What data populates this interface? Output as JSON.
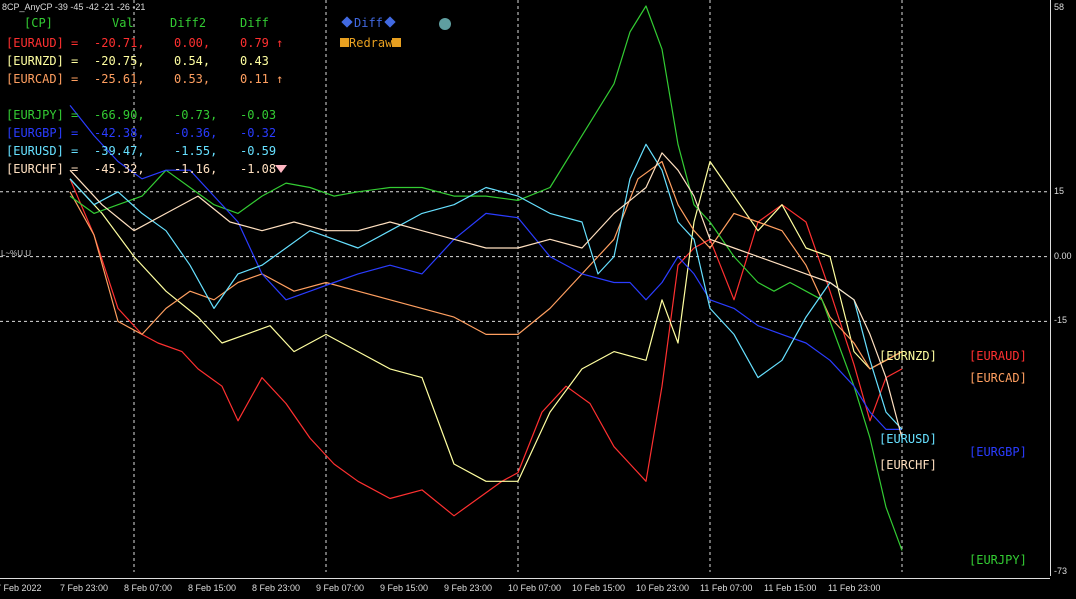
{
  "window": {
    "title": "8CP_AnyCP -39 -45 -42 -21 -26 -21"
  },
  "table": {
    "headers": [
      "[CP]",
      "Val",
      "Diff2",
      "Diff"
    ],
    "rows": [
      {
        "pair": "[EURAUD]",
        "val": "-20.71,",
        "diff2": "0.00,",
        "diff": "0.79",
        "arrow": "↑",
        "color": "#ff3030"
      },
      {
        "pair": "[EURNZD]",
        "val": "-20.75,",
        "diff2": "0.54,",
        "diff": "0.43",
        "arrow": "",
        "color": "#ffffa0"
      },
      {
        "pair": "[EURCAD]",
        "val": "-25.61,",
        "diff2": "0.53,",
        "diff": "0.11",
        "arrow": "↑",
        "color": "#ff9f60"
      },
      {
        "pair": "[EURJPY]",
        "val": "-66.90,",
        "diff2": "-0.73,",
        "diff": "-0.03",
        "arrow": "",
        "color": "#33cc33"
      },
      {
        "pair": "[EURGBP]",
        "val": "-42.38,",
        "diff2": "-0.36,",
        "diff": "-0.32",
        "arrow": "",
        "color": "#2a3cff"
      },
      {
        "pair": "[EURUSD]",
        "val": "-39.47,",
        "diff2": "-1.55,",
        "diff": "-0.59",
        "arrow": "",
        "color": "#66e0ff"
      },
      {
        "pair": "[EURCHF]",
        "val": "-45.32,",
        "diff2": "-1.16,",
        "diff": "-1.08",
        "arrow": "",
        "color": "#ffe0c0"
      }
    ]
  },
  "buttons": {
    "diff_label": "Diff",
    "redraw_label": "Redraw"
  },
  "level_label": "L~%U.U",
  "legend": {
    "eurnzd": "[EURNZD]",
    "euraud": "[EURAUD]",
    "eurcad": "[EURCAD]",
    "eurusd": "[EURUSD]",
    "eurgbp": "[EURGBP]",
    "eurchf": "[EURCHF]",
    "eurjpy": "[EURJPY]"
  },
  "chart_data": {
    "type": "line",
    "ylim": [
      -73,
      58
    ],
    "y_ticks": [
      "58",
      "15",
      "0.00",
      "-15",
      "-73"
    ],
    "y_tick_values": [
      58,
      15,
      0,
      -15,
      -73
    ],
    "x_ticks": [
      "7 Feb 2022",
      "7 Feb 23:00",
      "8 Feb 07:00",
      "8 Feb 15:00",
      "8 Feb 23:00",
      "9 Feb 07:00",
      "9 Feb 15:00",
      "9 Feb 23:00",
      "10 Feb 07:00",
      "10 Feb 15:00",
      "10 Feb 23:00",
      "11 Feb 07:00",
      "11 Feb 15:00",
      "11 Feb 23:00"
    ],
    "x_tick_index": [
      0,
      16,
      32,
      48,
      64,
      80,
      96,
      112,
      128,
      144,
      160,
      176,
      192,
      208
    ],
    "x_max": 216,
    "grid": true,
    "dashed_x_index": [
      16,
      64,
      112,
      160,
      208
    ],
    "series": [
      {
        "name": "EURAUD",
        "color": "#ff3030",
        "x": [
          0,
          6,
          12,
          18,
          22,
          28,
          32,
          38,
          42,
          48,
          54,
          60,
          66,
          72,
          80,
          88,
          96,
          102,
          108,
          112,
          118,
          124,
          130,
          136,
          140,
          144,
          148,
          152,
          156,
          160,
          166,
          172,
          178,
          184,
          190,
          196,
          200,
          204,
          208
        ],
        "y": [
          18,
          5,
          -12,
          -18,
          -20,
          -22,
          -26,
          -30,
          -38,
          -28,
          -34,
          -42,
          -48,
          -52,
          -56,
          -54,
          -60,
          -56,
          -52,
          -50,
          -36,
          -30,
          -34,
          -44,
          -48,
          -52,
          -30,
          -2,
          2,
          4,
          -10,
          8,
          12,
          8,
          -8,
          -25,
          -38,
          -28,
          -26
        ]
      },
      {
        "name": "EURNZD",
        "color": "#ffffa0",
        "x": [
          0,
          8,
          16,
          24,
          32,
          38,
          44,
          50,
          56,
          64,
          72,
          80,
          88,
          96,
          104,
          112,
          120,
          128,
          136,
          144,
          148,
          152,
          156,
          160,
          166,
          172,
          178,
          184,
          190,
          196,
          200,
          204,
          208
        ],
        "y": [
          18,
          10,
          0,
          -8,
          -14,
          -20,
          -18,
          -16,
          -22,
          -18,
          -22,
          -26,
          -28,
          -48,
          -52,
          -52,
          -36,
          -26,
          -22,
          -24,
          -10,
          -20,
          8,
          22,
          14,
          6,
          12,
          2,
          0,
          -22,
          -26,
          -24,
          -22
        ]
      },
      {
        "name": "EURCAD",
        "color": "#ff9f60",
        "x": [
          0,
          6,
          12,
          18,
          24,
          30,
          36,
          42,
          48,
          56,
          64,
          72,
          80,
          88,
          96,
          104,
          112,
          120,
          128,
          136,
          142,
          148,
          152,
          156,
          160,
          166,
          172,
          178,
          184,
          190,
          196,
          200,
          204,
          208
        ],
        "y": [
          15,
          5,
          -15,
          -18,
          -12,
          -8,
          -10,
          -6,
          -4,
          -8,
          -6,
          -8,
          -10,
          -12,
          -14,
          -18,
          -18,
          -12,
          -4,
          4,
          18,
          22,
          12,
          6,
          2,
          10,
          8,
          6,
          -2,
          -14,
          -20,
          -26,
          -24,
          -22
        ]
      },
      {
        "name": "EURJPY",
        "color": "#33cc33",
        "x": [
          0,
          6,
          12,
          18,
          24,
          30,
          36,
          42,
          48,
          54,
          60,
          66,
          72,
          80,
          88,
          96,
          104,
          112,
          120,
          128,
          136,
          140,
          144,
          148,
          152,
          156,
          160,
          166,
          172,
          176,
          180,
          184,
          188,
          192,
          196,
          200,
          204,
          208
        ],
        "y": [
          14,
          10,
          12,
          14,
          20,
          16,
          12,
          10,
          14,
          17,
          16,
          14,
          15,
          16,
          16,
          14,
          14,
          13,
          16,
          28,
          40,
          52,
          58,
          48,
          26,
          12,
          8,
          0,
          -6,
          -8,
          -6,
          -8,
          -10,
          -20,
          -30,
          -42,
          -58,
          -68
        ]
      },
      {
        "name": "EURGBP",
        "color": "#2a3cff",
        "x": [
          0,
          6,
          12,
          18,
          24,
          30,
          36,
          42,
          48,
          54,
          60,
          66,
          72,
          80,
          88,
          96,
          104,
          112,
          120,
          128,
          136,
          140,
          144,
          148,
          152,
          156,
          160,
          166,
          172,
          178,
          184,
          190,
          196,
          200,
          204,
          208
        ],
        "y": [
          35,
          28,
          22,
          18,
          20,
          20,
          14,
          8,
          -4,
          -10,
          -8,
          -6,
          -4,
          -2,
          -4,
          4,
          10,
          9,
          0,
          -4,
          -6,
          -6,
          -10,
          -6,
          0,
          -4,
          -10,
          -12,
          -16,
          -18,
          -20,
          -24,
          -30,
          -36,
          -40,
          -40
        ]
      },
      {
        "name": "EURUSD",
        "color": "#66e0ff",
        "x": [
          0,
          6,
          12,
          18,
          24,
          30,
          36,
          42,
          48,
          54,
          60,
          66,
          72,
          80,
          88,
          96,
          104,
          112,
          120,
          128,
          132,
          136,
          140,
          144,
          148,
          152,
          156,
          160,
          166,
          172,
          178,
          184,
          190,
          196,
          200,
          204,
          208
        ],
        "y": [
          18,
          12,
          15,
          10,
          6,
          -2,
          -12,
          -4,
          -2,
          2,
          6,
          4,
          2,
          6,
          10,
          12,
          16,
          14,
          10,
          8,
          -4,
          0,
          18,
          26,
          20,
          8,
          4,
          -12,
          -18,
          -28,
          -24,
          -14,
          -6,
          -10,
          -24,
          -36,
          -40
        ]
      },
      {
        "name": "EURCHF",
        "color": "#ffe0c0",
        "x": [
          0,
          8,
          16,
          24,
          32,
          40,
          48,
          56,
          64,
          72,
          80,
          88,
          96,
          104,
          112,
          120,
          128,
          136,
          144,
          148,
          152,
          156,
          160,
          166,
          172,
          178,
          184,
          190,
          196,
          200,
          204,
          208
        ],
        "y": [
          20,
          12,
          6,
          10,
          14,
          8,
          6,
          8,
          6,
          6,
          8,
          6,
          4,
          2,
          2,
          4,
          2,
          10,
          16,
          24,
          20,
          14,
          4,
          2,
          0,
          -2,
          -4,
          -6,
          -10,
          -18,
          -28,
          -42
        ]
      }
    ]
  }
}
